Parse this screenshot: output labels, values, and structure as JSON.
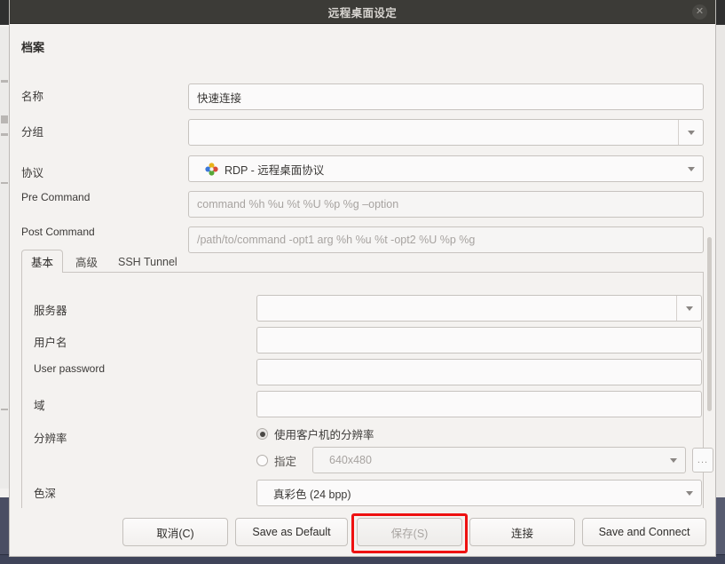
{
  "window": {
    "title": "远程桌面设定",
    "close_icon": "close-icon"
  },
  "profile": {
    "section_title": "档案",
    "rows": [
      {
        "label": "名称",
        "value": "快速连接",
        "kind": "text"
      },
      {
        "label": "分组",
        "value": "",
        "kind": "combo-split"
      },
      {
        "label": "协议",
        "value": "RDP - 远程桌面协议",
        "kind": "combo-icon"
      },
      {
        "label": "Pre Command",
        "value": "command %h %u %t %U %p %g –option",
        "kind": "placeholder"
      },
      {
        "label": "Post Command",
        "value": "/path/to/command -opt1 arg %h %u %t -opt2 %U %p %g",
        "kind": "placeholder"
      }
    ]
  },
  "tabs": [
    {
      "label": "基本",
      "active": true
    },
    {
      "label": "高级",
      "active": false
    },
    {
      "label": "SSH Tunnel",
      "active": false
    }
  ],
  "basic": {
    "rows": [
      {
        "label": "服务器",
        "value": "",
        "kind": "combo-split"
      },
      {
        "label": "用户名",
        "value": "",
        "kind": "text"
      },
      {
        "label": "User password",
        "value": "",
        "kind": "text"
      },
      {
        "label": "域",
        "value": "",
        "kind": "text"
      }
    ],
    "resolution": {
      "label": "分辨率",
      "use_client_label": "使用客户机的分辨率",
      "use_client_selected": true,
      "custom_label": "指定",
      "custom_selected": false,
      "custom_value": "640x480",
      "browse_label": "..."
    },
    "color_depth": {
      "label": "色深",
      "value": "真彩色 (24 bpp)"
    }
  },
  "footer": {
    "buttons": [
      {
        "label": "取消(C)",
        "disabled": false
      },
      {
        "label": "Save as Default",
        "disabled": false
      },
      {
        "label": "保存(S)",
        "disabled": true
      },
      {
        "label": "连接",
        "disabled": false
      },
      {
        "label": "Save and Connect",
        "disabled": false
      }
    ]
  },
  "colors": {
    "titlebar": "#3c3b37",
    "dialog_bg": "#f4f2f0",
    "highlight": "#ee1111"
  }
}
